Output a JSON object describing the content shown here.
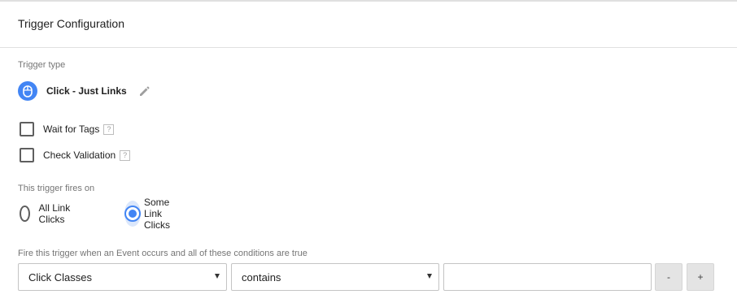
{
  "header": {
    "title": "Trigger Configuration"
  },
  "trigger_type": {
    "label": "Trigger type",
    "name": "Click - Just Links",
    "icon": "mouse-icon",
    "icon_color": "#4285f4"
  },
  "options": [
    {
      "label": "Wait for Tags",
      "checked": false,
      "help": "?"
    },
    {
      "label": "Check Validation",
      "checked": false,
      "help": "?"
    }
  ],
  "fires_on": {
    "label": "This trigger fires on",
    "choices": [
      {
        "label": "All Link Clicks",
        "selected": false
      },
      {
        "label": "Some Link Clicks",
        "selected": true
      }
    ]
  },
  "conditions": {
    "label": "Fire this trigger when an Event occurs and all of these conditions are true",
    "variable": "Click Classes",
    "operator": "contains",
    "value": "",
    "remove_label": "-",
    "add_label": "+"
  },
  "colors": {
    "accent": "#4285f4",
    "halo": "#dbe7fb",
    "divider": "#e0e0e0"
  }
}
